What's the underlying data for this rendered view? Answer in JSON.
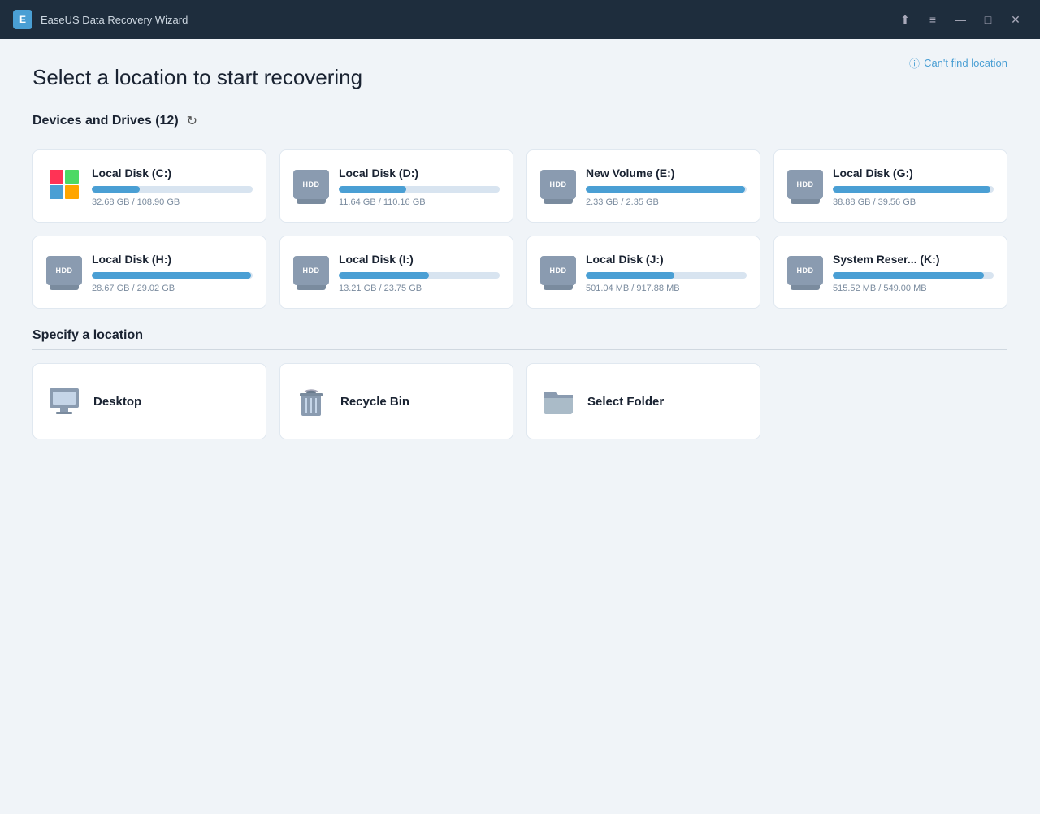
{
  "titleBar": {
    "appName": "EaseUS Data Recovery Wizard",
    "iconText": "E",
    "controls": {
      "share": "⬆",
      "menu": "≡",
      "minimize": "—",
      "maximize": "□",
      "close": "✕"
    }
  },
  "header": {
    "cantFindLabel": "Can't find location",
    "pageTitle": "Select a location to start recovering"
  },
  "devicesSection": {
    "title": "Devices and Drives (12)",
    "drives": [
      {
        "name": "Local Disk (C:)",
        "type": "windows",
        "usedGB": 32.68,
        "totalGB": 108.9,
        "usedLabel": "32.68 GB / 108.90 GB",
        "fillPercent": 30
      },
      {
        "name": "Local Disk (D:)",
        "type": "hdd",
        "usedGB": 11.64,
        "totalGB": 110.16,
        "usedLabel": "11.64 GB / 110.16 GB",
        "fillPercent": 42
      },
      {
        "name": "New Volume (E:)",
        "type": "hdd",
        "usedGB": 2.33,
        "totalGB": 2.35,
        "usedLabel": "2.33 GB / 2.35 GB",
        "fillPercent": 99
      },
      {
        "name": "Local Disk (G:)",
        "type": "hdd",
        "usedGB": 38.88,
        "totalGB": 39.56,
        "usedLabel": "38.88 GB / 39.56 GB",
        "fillPercent": 98
      },
      {
        "name": "Local Disk (H:)",
        "type": "hdd",
        "usedGB": 28.67,
        "totalGB": 29.02,
        "usedLabel": "28.67 GB / 29.02 GB",
        "fillPercent": 99
      },
      {
        "name": "Local Disk (I:)",
        "type": "hdd",
        "usedGB": 13.21,
        "totalGB": 23.75,
        "usedLabel": "13.21 GB / 23.75 GB",
        "fillPercent": 56
      },
      {
        "name": "Local Disk (J:)",
        "type": "hdd",
        "usedGB": 501.04,
        "totalGB": 917.88,
        "usedLabel": "501.04 MB / 917.88 MB",
        "fillPercent": 55
      },
      {
        "name": "System Reser... (K:)",
        "type": "hdd",
        "usedGB": 515.52,
        "totalGB": 549.0,
        "usedLabel": "515.52 MB / 549.00 MB",
        "fillPercent": 94
      }
    ]
  },
  "specifySection": {
    "title": "Specify a location",
    "locations": [
      {
        "name": "Desktop",
        "icon": "desktop"
      },
      {
        "name": "Recycle Bin",
        "icon": "recycle"
      },
      {
        "name": "Select Folder",
        "icon": "folder"
      }
    ]
  }
}
